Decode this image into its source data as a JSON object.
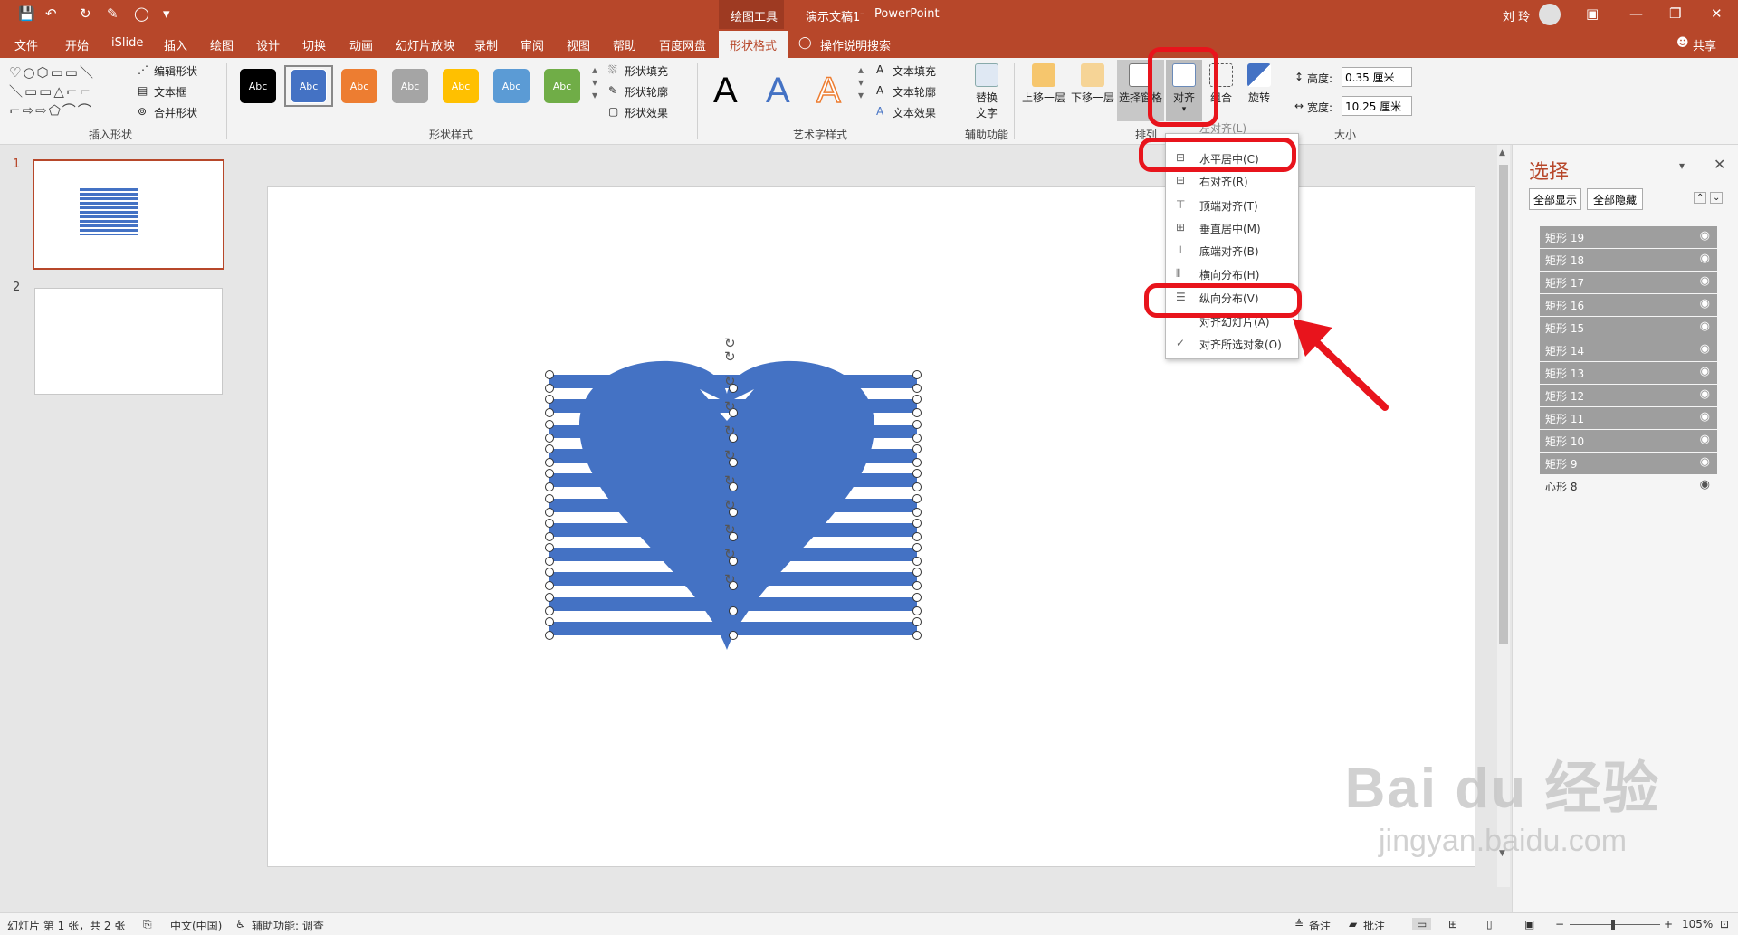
{
  "window": {
    "tools_context": "绘图工具",
    "title": "演示文稿1",
    "title_sep": "-",
    "app": "PowerPoint",
    "user": "刘 玲",
    "accent": "#b7472a"
  },
  "quick_access": [
    "save-icon",
    "undo-icon",
    "redo-icon",
    "format-painter-icon",
    "presenter-icon",
    "customize-icon"
  ],
  "ribbon_tabs": [
    "文件",
    "开始",
    "iSlide",
    "插入",
    "绘图",
    "设计",
    "切换",
    "动画",
    "幻灯片放映",
    "录制",
    "审阅",
    "视图",
    "帮助",
    "百度网盘",
    "形状格式"
  ],
  "active_tab": "形状格式",
  "tell_me": "操作说明搜索",
  "share": "共享",
  "groups": {
    "insert_shapes": {
      "label": "插入形状",
      "edit_shape": "编辑形状",
      "text_box": "文本框",
      "merge_shapes": "合并形状"
    },
    "shape_styles": {
      "label": "形状样式",
      "swatch_text": "Abc",
      "swatches": [
        "#000000",
        "#4472c4",
        "#ed7d31",
        "#a5a5a5",
        "#ffc000",
        "#5b9bd5",
        "#70ad47"
      ],
      "fill": "形状填充",
      "outline": "形状轮廓",
      "effects": "形状效果"
    },
    "wordart": {
      "label": "艺术字样式",
      "letter": "A",
      "text_fill": "文本填充",
      "text_outline": "文本轮廓",
      "text_effects": "文本效果"
    },
    "accessibility": {
      "label": "辅助功能",
      "alt_text_line1": "替换",
      "alt_text_line2": "文字"
    },
    "arrange": {
      "label": "排列",
      "bring_forward": "上移一层",
      "send_backward": "下移一层",
      "selection_pane": "选择窗格",
      "align": "对齐",
      "group": "组合",
      "rotate": "旋转"
    },
    "size": {
      "label": "大小",
      "height_label": "高度:",
      "height_value": "0.35 厘米",
      "width_label": "宽度:",
      "width_value": "10.25 厘米"
    }
  },
  "align_menu": {
    "items": [
      {
        "label": "左对齐(L)",
        "icon": "align-left-icon"
      },
      {
        "label": "水平居中(C)",
        "icon": "align-center-icon"
      },
      {
        "label": "右对齐(R)",
        "icon": "align-right-icon"
      },
      {
        "label": "顶端对齐(T)",
        "icon": "align-top-icon"
      },
      {
        "label": "垂直居中(M)",
        "icon": "align-middle-icon"
      },
      {
        "label": "底端对齐(B)",
        "icon": "align-bottom-icon"
      },
      {
        "label": "横向分布(H)",
        "icon": "distribute-horizontal-icon"
      },
      {
        "label": "纵向分布(V)",
        "icon": "distribute-vertical-icon"
      },
      {
        "label": "对齐幻灯片(A)",
        "icon": ""
      },
      {
        "label": "对齐所选对象(O)",
        "icon": "checkmark-icon"
      }
    ]
  },
  "slides": [
    {
      "number": "1"
    },
    {
      "number": "2"
    }
  ],
  "selection_pane": {
    "title": "选择",
    "show_all": "全部显示",
    "hide_all": "全部隐藏",
    "items": [
      "矩形 19",
      "矩形 18",
      "矩形 17",
      "矩形 16",
      "矩形 15",
      "矩形 14",
      "矩形 13",
      "矩形 12",
      "矩形 11",
      "矩形 10",
      "矩形 9",
      "心形 8"
    ],
    "selected_color": "#9e9e9e"
  },
  "status": {
    "slide_info": "幻灯片 第 1 张，共 2 张",
    "language": "中文(中国)",
    "accessibility": "辅助功能: 调查",
    "notes": "备注",
    "comments": "批注",
    "zoom": "105%"
  },
  "watermark": {
    "brand": "Bai du 经验",
    "url": "jingyan.baidu.com"
  },
  "shape_color": "#4472c4",
  "annotation_color": "#e8141c"
}
